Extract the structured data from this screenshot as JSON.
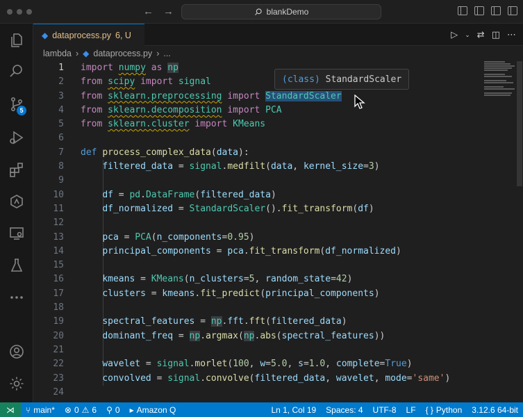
{
  "window": {
    "title": "blankDemo"
  },
  "tab": {
    "label": "dataprocess.py",
    "status": "6, U"
  },
  "breadcrumbs": [
    "lambda",
    "dataprocess.py",
    "..."
  ],
  "hover": {
    "keyword": "(class)",
    "name": "StandardScaler"
  },
  "activity": {
    "scm_badge": "5"
  },
  "editor": {
    "line_numbers": [
      "1",
      "2",
      "3",
      "4",
      "5",
      "6",
      "7",
      "8",
      "9",
      "10",
      "11",
      "12",
      "13",
      "14",
      "15",
      "16",
      "17",
      "18",
      "19",
      "20",
      "21",
      "22",
      "23",
      "24"
    ],
    "active_line": 1
  },
  "status": {
    "branch": "main*",
    "errors": "0",
    "warnings": "6",
    "ports": "0",
    "amazon": "Amazon Q",
    "position": "Ln 1, Col 19",
    "spaces": "Spaces: 4",
    "encoding": "UTF-8",
    "eol": "LF",
    "language": "Python",
    "interpreter": "3.12.6 64-bit"
  }
}
